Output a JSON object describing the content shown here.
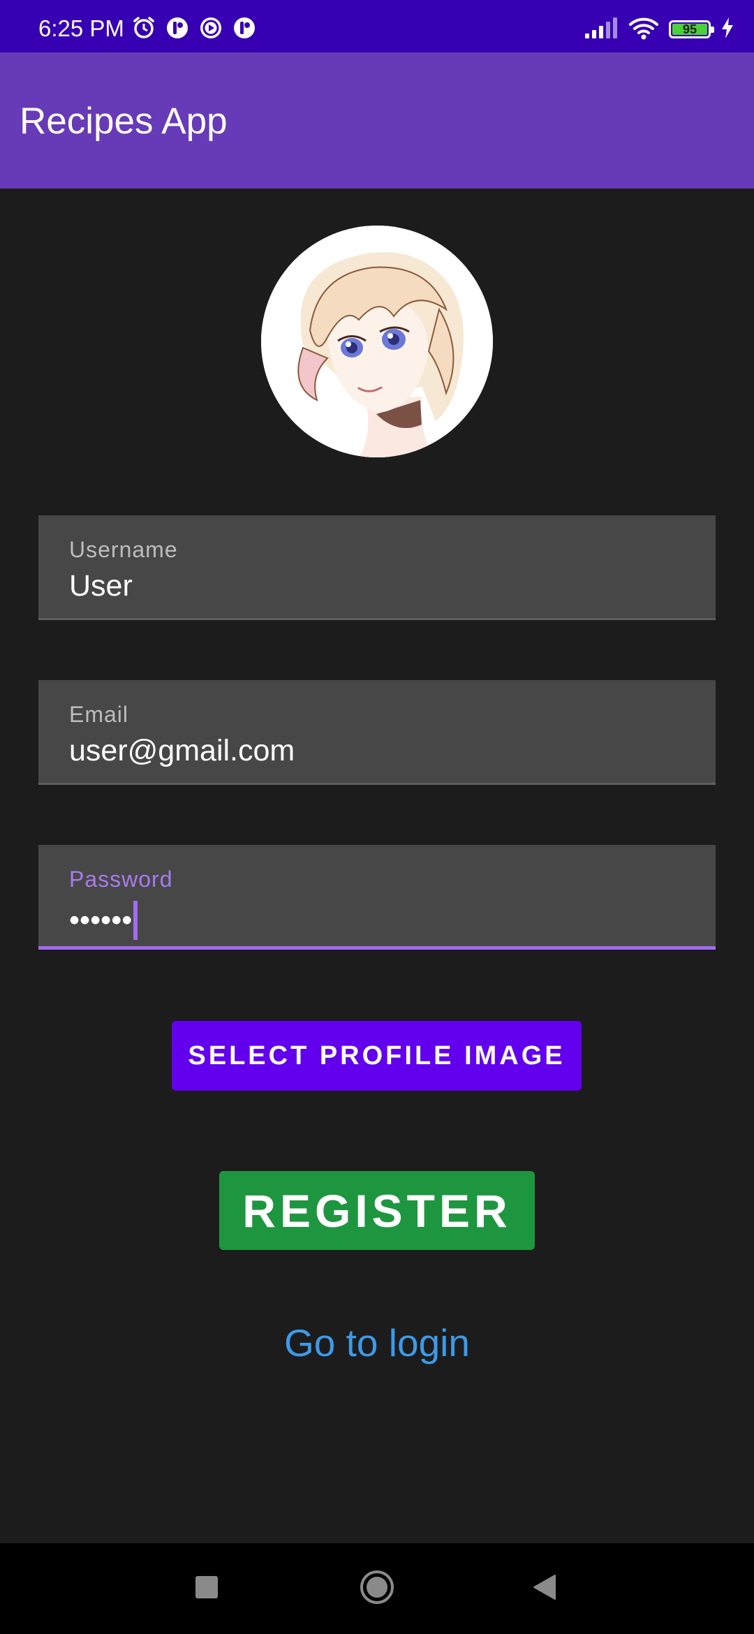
{
  "status_bar": {
    "time": "6:25 PM",
    "battery_level": "95",
    "left_icons": [
      "alarm-icon",
      "notification-app-icon",
      "play-notification-icon",
      "notification-app-icon"
    ],
    "right_icons": [
      "cellular-signal-icon",
      "wifi-icon",
      "battery-icon",
      "charging-bolt-icon"
    ]
  },
  "app_bar": {
    "title": "Recipes App",
    "color": "#673ab7"
  },
  "profile": {
    "avatar_icon": "anime-girl-avatar"
  },
  "form": {
    "username": {
      "label": "Username",
      "value": "User"
    },
    "email": {
      "label": "Email",
      "value": "user@gmail.com"
    },
    "password": {
      "label": "Password",
      "value": "••••••",
      "focused": true
    }
  },
  "buttons": {
    "select_image_label": "SELECT PROFILE IMAGE",
    "register_label": "REGISTER",
    "login_link_label": "Go to login"
  },
  "navigation": {
    "icons": [
      "recents-square-icon",
      "home-circle-icon",
      "back-triangle-icon"
    ]
  },
  "colors": {
    "status_bar": "#3700b3",
    "background": "#1c1c1c",
    "accent": "#a06cf0",
    "select_button": "#6200ee",
    "register_button": "#1e9640",
    "link": "#3d9ae8"
  }
}
